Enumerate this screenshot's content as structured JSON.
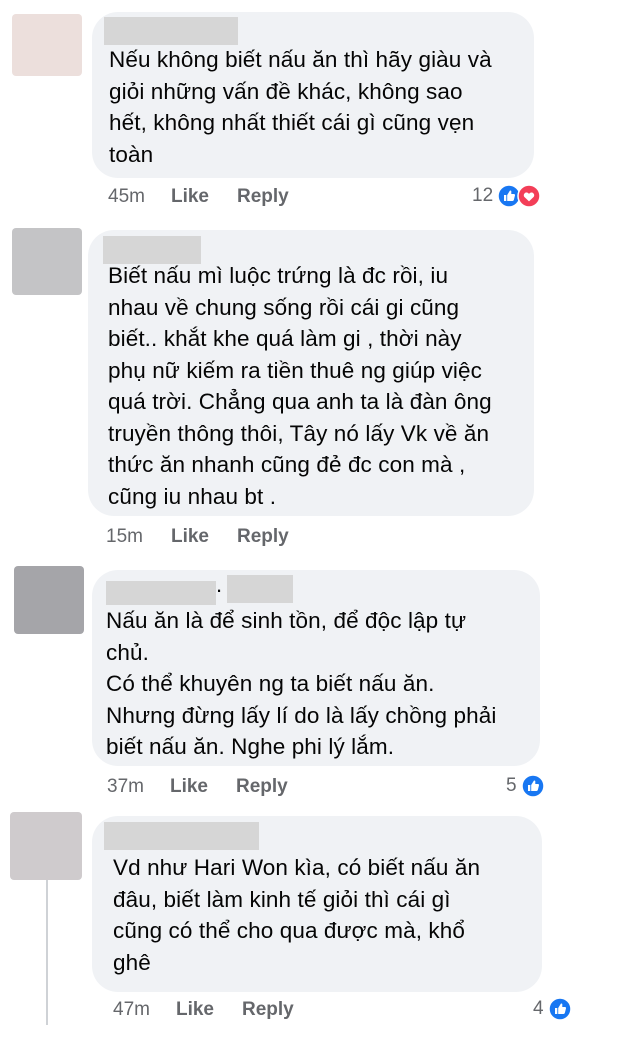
{
  "comments": [
    {
      "lines": [
        "Nếu không biết nấu ăn thì hãy giàu và",
        "giỏi những vấn đề khác, không sao",
        "hết, không nhất thiết cái gì cũng vẹn",
        "toàn"
      ],
      "time": "45m",
      "like_label": "Like",
      "reply_label": "Reply",
      "reaction_count": "12",
      "reactions": [
        "like-icon",
        "love-icon"
      ],
      "avatar_color": "#ecdfdc"
    },
    {
      "lines": [
        "Biết nấu mì luộc trứng là đc rồi, iu",
        "nhau về chung sống rồi cái gi cũng",
        "biết.. khắt khe quá làm gi , thời này",
        "phụ nữ kiếm ra tiền thuê ng giúp việc",
        "quá trời. Chẳng qua anh ta là đàn ông",
        "truyền thông thôi, Tây nó lấy Vk về ăn",
        "thức ăn nhanh cũng đẻ đc con mà ,",
        "cũng iu nhau bt ."
      ],
      "time": "15m",
      "like_label": "Like",
      "reply_label": "Reply",
      "reaction_count": "",
      "reactions": [],
      "avatar_color": "#c4c4c6"
    },
    {
      "name_suffix": ".",
      "lines": [
        "Nấu ăn là để sinh tồn, để độc lập tự",
        "chủ.",
        "Có thể khuyên ng ta biết nấu ăn.",
        "Nhưng đừng lấy lí do là lấy chồng phải",
        "biết nấu ăn. Nghe phi lý lắm."
      ],
      "time": "37m",
      "like_label": "Like",
      "reply_label": "Reply",
      "reaction_count": "5",
      "reactions": [
        "like-icon"
      ],
      "avatar_color": "#a5a5a9"
    },
    {
      "lines": [
        "Vd như Hari Won kìa, có biết nấu ăn",
        "đâu, biết làm kinh tế giỏi thì cái gì",
        "cũng có thể cho qua được mà, khổ",
        "ghê"
      ],
      "time": "47m",
      "like_label": "Like",
      "reply_label": "Reply",
      "reaction_count": "4",
      "reactions": [
        "like-icon"
      ],
      "avatar_color": "#cfcbcd"
    }
  ],
  "colors": {
    "bubble": "#f0f2f5",
    "meta_text": "#65676b",
    "like_blue": "#1877f2",
    "love_red": "#f33e58"
  }
}
